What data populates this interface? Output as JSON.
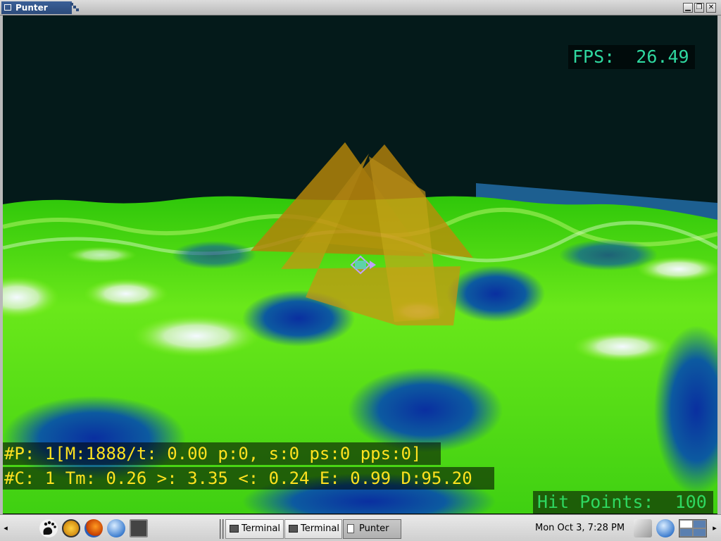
{
  "window": {
    "title": "Punter",
    "buttons": [
      {
        "name": "minimize",
        "glyph": "▁"
      },
      {
        "name": "maximize",
        "glyph": "❐"
      },
      {
        "name": "close",
        "glyph": "✕"
      }
    ]
  },
  "hud": {
    "fps": "FPS:  26.49",
    "stats_line1": "#P: 1[M:1888/t: 0.00 p:0, s:0 ps:0 pps:0]",
    "stats_line2": "#C: 1 Tm: 0.26 >: 3.35 <: 0.24 E: 0.99 D:95.20",
    "hit_points": "Hit Points:  100"
  },
  "colors": {
    "sky": "#041a1a",
    "terrain_light": "#7ef01a",
    "terrain_mid": "#2fc70a",
    "terrain_shadow": "#0b3fa8",
    "terrain_highlight": "#e8f4ff",
    "pyramid": "#c08a0a",
    "water": "#1d5f90",
    "hud_fps": "#2fd8a0",
    "hud_stats": "#ffe21f",
    "hud_hp": "#2fd860"
  },
  "taskbar": {
    "left_arrow": "◂",
    "right_arrow": "▸",
    "launchers": [
      {
        "name": "gnome-foot-icon"
      },
      {
        "name": "mail-icon"
      },
      {
        "name": "firefox-icon"
      },
      {
        "name": "globe-icon"
      },
      {
        "name": "terminal-launcher-icon"
      }
    ],
    "tasks": [
      {
        "label": "Terminal",
        "active": false
      },
      {
        "label": "Terminal",
        "active": false
      },
      {
        "label": "Punter",
        "active": true
      }
    ],
    "clock": "Mon Oct  3,  7:28 PM"
  }
}
